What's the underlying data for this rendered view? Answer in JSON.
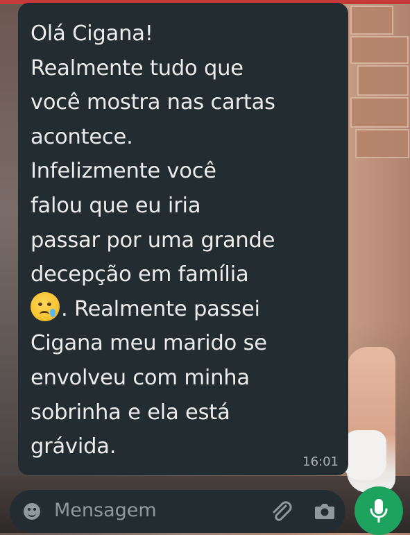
{
  "message": {
    "lines": [
      "Olá Cigana!",
      "Realmente tudo que",
      "você mostra nas cartas",
      "acontece.",
      "Infelizmente você",
      "falou que eu iria",
      "passar por uma grande",
      "decepção em família"
    ],
    "emoji_line_text": ". Realmente passei",
    "lines_after": [
      "Cigana  meu marido se",
      "envolveu com minha",
      "sobrinha e ela está",
      "grávida."
    ],
    "time": "16:01",
    "emoji_icon": "crying-face-icon"
  },
  "composer": {
    "placeholder": "Mensagem",
    "icons": [
      "emoji-icon",
      "paperclip-icon",
      "camera-icon",
      "microphone-icon"
    ]
  },
  "colors": {
    "bubble": "#232d31",
    "text": "#ececec",
    "timestamp": "#a9b1b4",
    "mic_button": "#1ea35f"
  }
}
